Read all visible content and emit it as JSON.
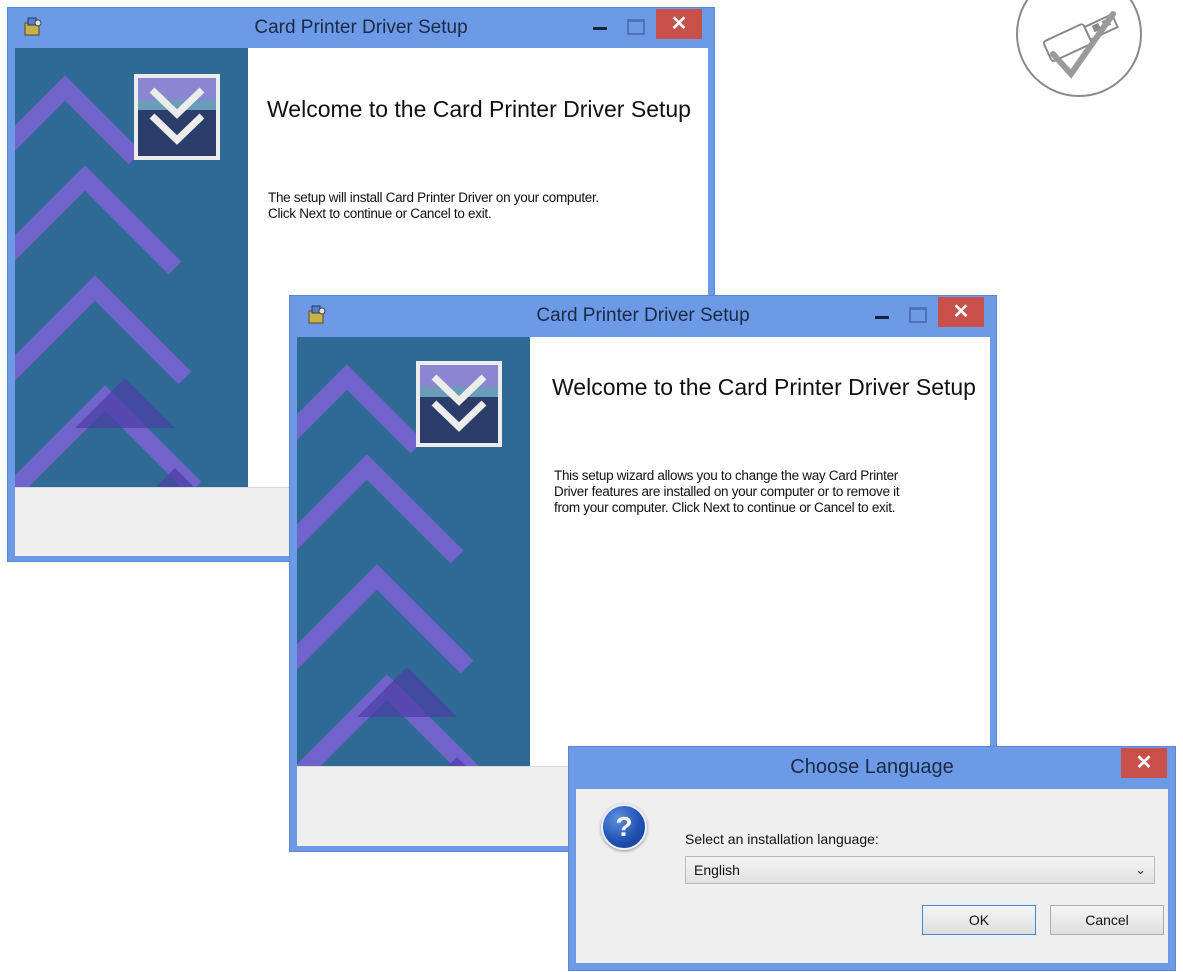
{
  "window1": {
    "title": "Card Printer Driver Setup",
    "heading": "Welcome to the Card Printer Driver Setup",
    "body_lines": [
      "The setup will install Card Printer Driver on your computer.",
      "Click Next to continue or Cancel to exit."
    ],
    "close_glyph": "✕"
  },
  "window2": {
    "title": "Card Printer Driver Setup",
    "heading": "Welcome to the Card Printer Driver Setup",
    "body_lines": [
      "This setup wizard allows you to change the way Card Printer",
      "Driver features are installed on your computer or to remove it",
      "from your computer. Click Next to continue or Cancel to exit."
    ],
    "close_glyph": "✕"
  },
  "dialog": {
    "title": "Choose Language",
    "prompt": "Select an installation language:",
    "selected_language": "English",
    "ok_label": "OK",
    "cancel_label": "Cancel",
    "close_glyph": "✕",
    "question_glyph": "?"
  },
  "icons": {
    "app_icon": "installer-icon",
    "logo": "double-chevron-logo",
    "badge": "usb-check-badge"
  },
  "colors": {
    "titlebar": "#6c9ae6",
    "close_button": "#c7504a",
    "banner": "#2f6a95",
    "banner_chevron": "#7c62d6"
  }
}
